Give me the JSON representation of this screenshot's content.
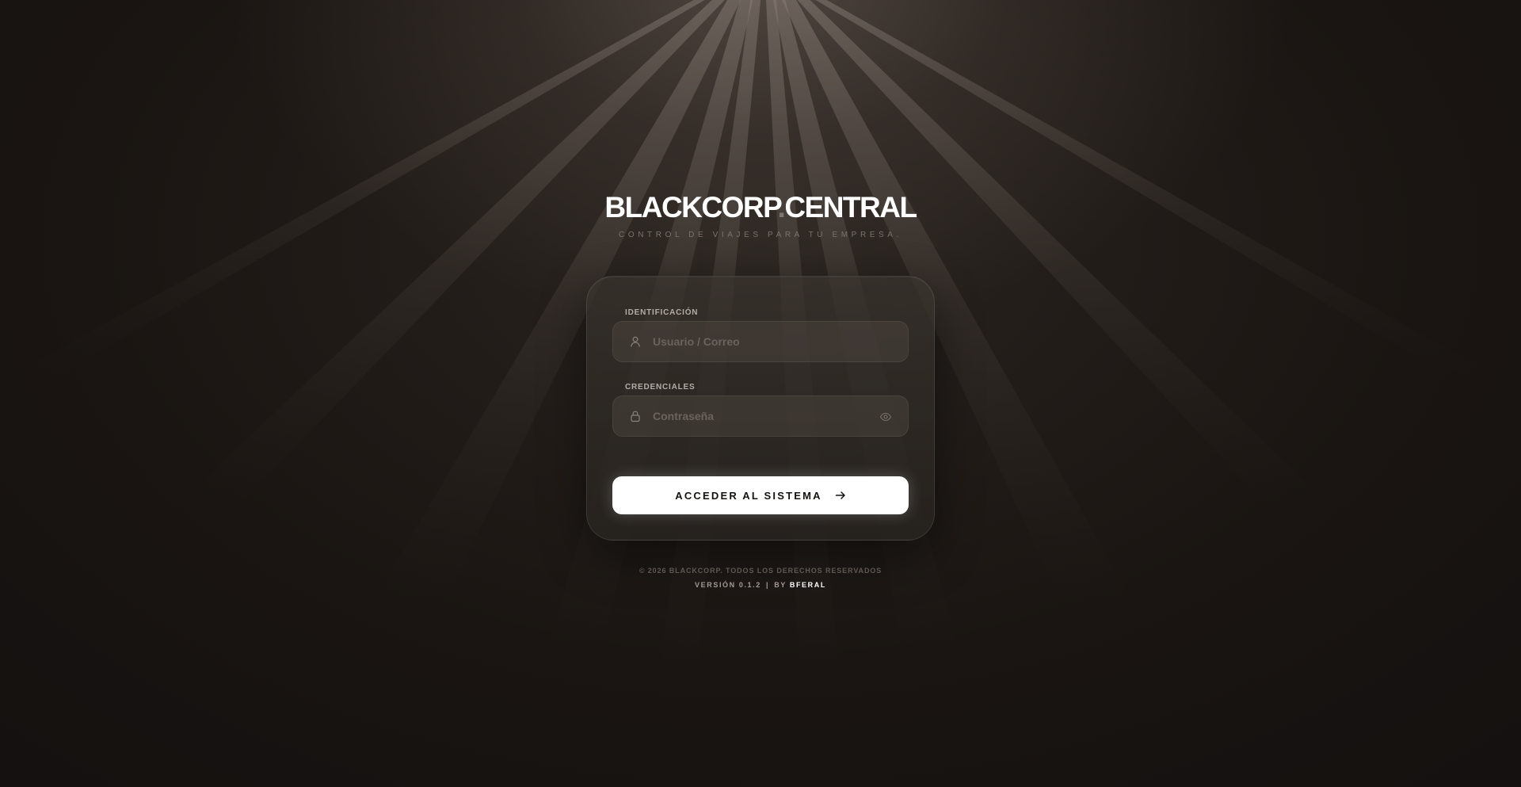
{
  "header": {
    "brand_left": "BLACKCORP",
    "brand_dot": ".",
    "brand_right": "CENTRAL",
    "tagline": "CONTROL DE VIAJES PARA TU EMPRESA."
  },
  "form": {
    "identification": {
      "label": "IDENTIFICACIÓN",
      "placeholder": "Usuario / Correo",
      "value": "",
      "icon": "user-icon"
    },
    "credentials": {
      "label": "CREDENCIALES",
      "placeholder": "Contraseña",
      "value": "",
      "icon": "lock-icon",
      "toggle_icon": "eye-icon"
    },
    "submit": {
      "label": "ACCEDER AL SISTEMA",
      "icon": "arrow-right-icon"
    }
  },
  "footer": {
    "copyright": "© 2026 BLACKCORP. TODOS LOS DERECHOS RESERVADOS",
    "version_prefix": "VERSIÓN 0.1.2",
    "separator": "|",
    "by_label": "BY",
    "author": "BFERAL"
  },
  "colors": {
    "background": "#1a1613",
    "accent_button": "#ffffff",
    "button_text": "#15120f",
    "muted_text": "#7a726c"
  }
}
